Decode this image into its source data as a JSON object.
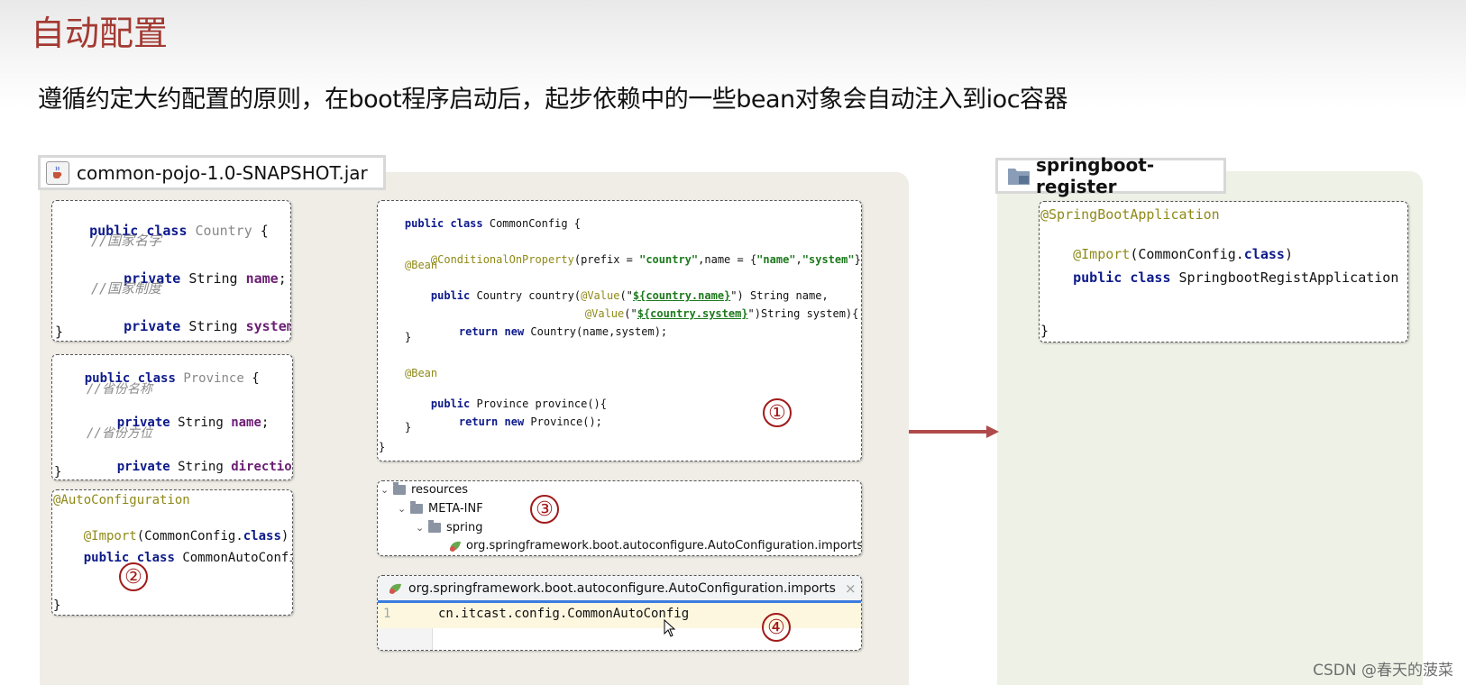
{
  "slide": {
    "title": "自动配置",
    "subtitle": "遵循约定大约配置的原则，在boot程序启动后，起步依赖中的一些bean对象会自动注入到ioc容器"
  },
  "left_panel": {
    "jar_name": "common-pojo-1.0-SNAPSHOT.jar"
  },
  "right_panel": {
    "project_name": "springboot-register"
  },
  "country_class": {
    "kw_public": "public",
    "kw_class": "class",
    "class_name": "Country",
    "open_brace": "{",
    "comment1": "//国家名字",
    "kw_private": "private",
    "type_string": "String",
    "field1": "name",
    "comment2": "//国家制度",
    "field2": "system",
    "close_brace": "}"
  },
  "province_class": {
    "class_name": "Province",
    "comment1": "//省份名称",
    "field1": "name",
    "comment2": "//省份方位",
    "field2": "direction"
  },
  "auto_config_class": {
    "annotation1": "@AutoConfiguration",
    "annotation2": "@Import",
    "import_arg": "CommonConfig.",
    "class_kw": "class",
    "declaration": "CommonAutoConfig {"
  },
  "common_config": {
    "declaration": "CommonConfig {",
    "conditional_annotation": "@ConditionalOnProperty",
    "conditional_prefix_key": "(prefix = ",
    "conditional_prefix_val": "\"country\"",
    "conditional_name_key": ",name = {",
    "conditional_name_val1": "\"name\"",
    "conditional_name_val2": "\"system\"",
    "conditional_end": "})",
    "bean_annotation": "@Bean",
    "country_method": "Country country(",
    "value_annotation": "@Value",
    "value1": "${country.name}",
    "param1": "String name,",
    "value2": "${country.system}",
    "param2": "String system){",
    "kw_return": "return",
    "kw_new": "new",
    "country_return": "Country(name,system);",
    "province_method": "Province province(){",
    "province_return": "Province();"
  },
  "resources_tree": {
    "items": [
      "resources",
      "META-INF",
      "spring",
      "org.springframework.boot.autoconfigure.AutoConfiguration.imports"
    ]
  },
  "imports_file": {
    "tab_label": "org.springframework.boot.autoconfigure.AutoConfiguration.imports",
    "close_symbol": "×",
    "line_number": "1",
    "line_content": "cn.itcast.config.CommonAutoConfig"
  },
  "register_app": {
    "annotation1": "@SpringBootApplication",
    "annotation2": "@Import",
    "import_arg": "(CommonConfig.",
    "class_kw": "class",
    "declaration": "SpringbootRegistApplication {",
    "close_brace": "}"
  },
  "markers": [
    "①",
    "②",
    "③",
    "④"
  ],
  "watermark": "CSDN @春天的菠菜",
  "colors": {
    "title": "#a33a33",
    "marker": "#a11a1a",
    "arrow": "#b04a4a",
    "keyword": "#0d1a8a",
    "annotation": "#8f8a18",
    "string": "#1d7a1d",
    "field": "#6b1f74",
    "left_panel_bg": "#efede6",
    "right_panel_bg": "#eef1e6"
  }
}
